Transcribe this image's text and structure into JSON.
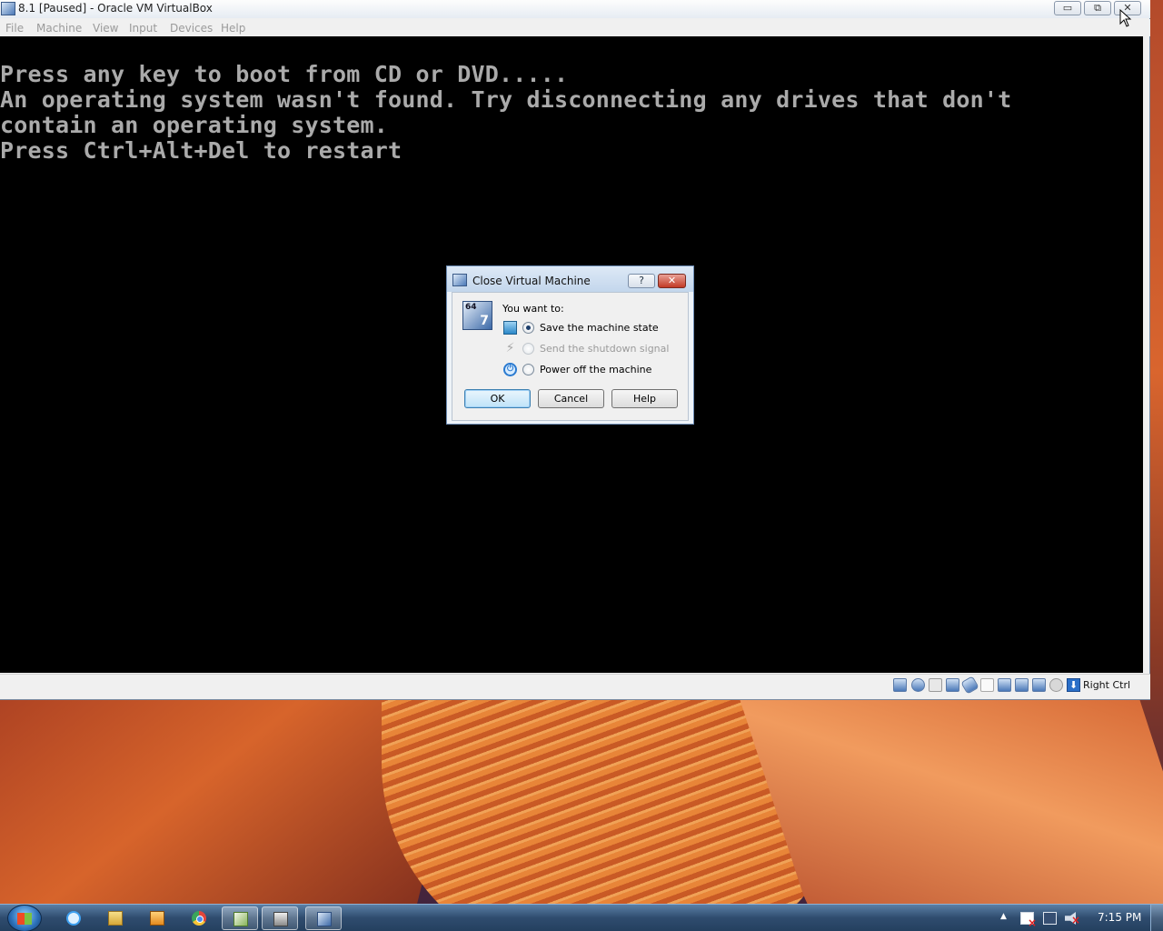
{
  "window": {
    "title": "8.1 [Paused] - Oracle VM VirtualBox",
    "buttons": {
      "minimize": "▭",
      "restore": "⧉",
      "close": "✕"
    }
  },
  "menubar": {
    "items": [
      "File",
      "Machine",
      "View",
      "Input",
      "Devices",
      "Help"
    ]
  },
  "console": {
    "lines": [
      "Press any key to boot from CD or DVD.....",
      "An operating system wasn't found. Try disconnecting any drives that don't",
      "contain an operating system.",
      "Press Ctrl+Alt+Del to restart"
    ],
    "color": "#aaaaaa"
  },
  "statusbar": {
    "icons": [
      "hard-disk-icon",
      "optical-drive-icon",
      "floppy-icon",
      "network-icon",
      "usb-icon",
      "shared-folders-icon",
      "display-icon",
      "video-capture-icon",
      "cpu-icon",
      "mouse-integration-icon"
    ],
    "hostkey": "Right Ctrl"
  },
  "dialog": {
    "title": "Close Virtual Machine",
    "help_button": "?",
    "close_button": "✕",
    "os_badge": "64",
    "os_version": "7",
    "prompt": "You want to:",
    "options": [
      {
        "label": "Save the machine state",
        "selected": true,
        "enabled": true
      },
      {
        "label": "Send the shutdown signal",
        "selected": false,
        "enabled": false
      },
      {
        "label": "Power off the machine",
        "selected": false,
        "enabled": true
      }
    ],
    "buttons": {
      "ok": "OK",
      "cancel": "Cancel",
      "help": "Help"
    }
  },
  "taskbar": {
    "pinned": [
      "internet-explorer-icon",
      "windows-explorer-icon",
      "media-player-icon",
      "chrome-icon",
      "virtualbox-manager-icon",
      "app-icon",
      "virtualbox-vm-icon"
    ],
    "tray_expand": "▲",
    "clock": "7:15 PM"
  }
}
